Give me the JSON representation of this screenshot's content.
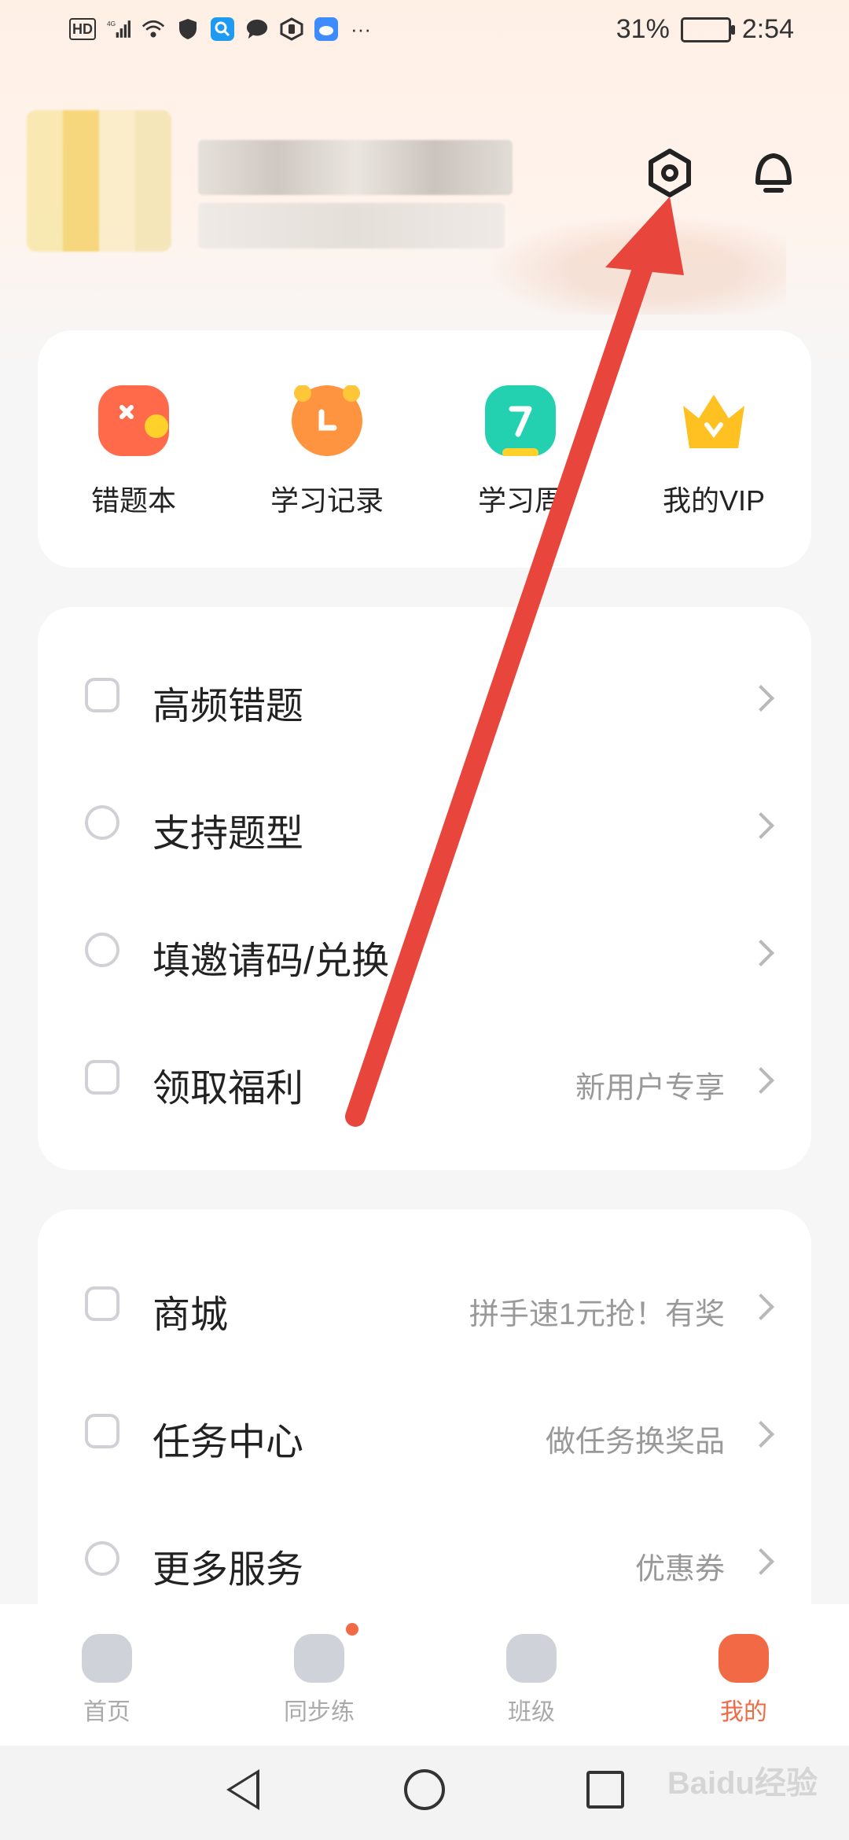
{
  "status_bar": {
    "left_icons": [
      "HD",
      "4G",
      "signal-icon",
      "wifi-icon",
      "shield-icon",
      "search-app-icon",
      "chat-icon",
      "hand-icon",
      "cloud-icon",
      "more-icon"
    ],
    "hd": "HD",
    "net": "4G",
    "more": "···",
    "battery_percent": "31%",
    "time": "2:54"
  },
  "header": {
    "settings_icon": "settings-hexagon-icon",
    "notification_icon": "bell-icon"
  },
  "quick_actions": [
    {
      "label": "错题本",
      "icon": "wrong-notebook-icon",
      "color": "#ff6b4a"
    },
    {
      "label": "学习记录",
      "icon": "alarm-clock-icon",
      "color": "#ff9440"
    },
    {
      "label": "学习周",
      "icon": "weekly-report-icon",
      "color": "#23d0b0"
    },
    {
      "label": "我的VIP",
      "icon": "crown-icon",
      "color": "#ffc021"
    }
  ],
  "menu_group_1": [
    {
      "label": "高频错题",
      "hint": ""
    },
    {
      "label": "支持题型",
      "hint": ""
    },
    {
      "label": "填邀请码/兑换",
      "hint": ""
    },
    {
      "label": "领取福利",
      "hint": "新用户专享"
    }
  ],
  "menu_group_2": [
    {
      "label": "商城",
      "hint": "拼手速1元抢！有奖"
    },
    {
      "label": "任务中心",
      "hint": "做任务换奖品"
    },
    {
      "label": "更多服务",
      "hint": "优惠券"
    }
  ],
  "tabbar": [
    {
      "label": "首页",
      "icon": "home-icon",
      "active": false
    },
    {
      "label": "同步练",
      "icon": "practice-icon",
      "active": false,
      "badge": true
    },
    {
      "label": "班级",
      "icon": "class-icon",
      "active": false
    },
    {
      "label": "我的",
      "icon": "profile-icon",
      "active": true
    }
  ],
  "accent_color": "#f26a45",
  "annotation_arrow_color": "#e8453c",
  "watermark": "Baidu经验"
}
